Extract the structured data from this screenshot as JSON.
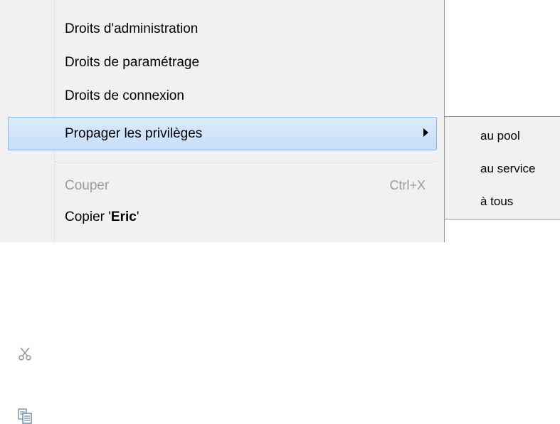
{
  "menu": {
    "items": [
      {
        "label": "Droits d'administration"
      },
      {
        "label": "Droits de paramétrage"
      },
      {
        "label": "Droits de connexion"
      },
      {
        "label": "Propager les privilèges"
      }
    ],
    "cut": {
      "label": "Couper",
      "shortcut": "Ctrl+X",
      "icon": "scissors-icon"
    },
    "copy": {
      "label_prefix": "Copier '",
      "label_bold": "Eric",
      "label_suffix": "'",
      "icon": "copy-icon"
    }
  },
  "submenu": {
    "items": [
      {
        "label": "au pool"
      },
      {
        "label": "au service"
      },
      {
        "label": "à tous"
      }
    ]
  },
  "colors": {
    "highlight": "#c7ddf7",
    "highlight_border": "#8cb4e6",
    "disabled_text": "#9b9b9b",
    "menu_bg": "#f1f1f1"
  }
}
